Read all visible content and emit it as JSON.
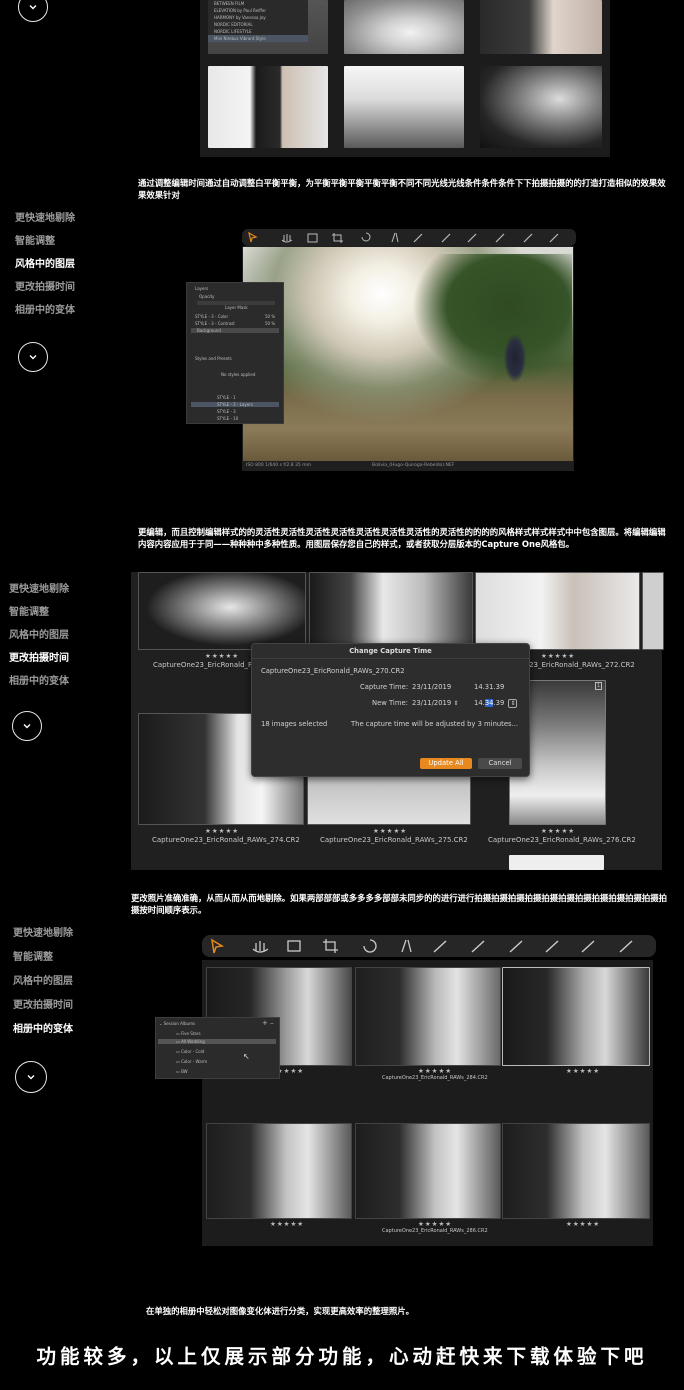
{
  "nav_items": [
    "更快速地剔除",
    "智能调整",
    "风格中的图层",
    "更改拍摄时间",
    "相册中的变体"
  ],
  "sections": {
    "s1": {
      "caption": "通过调整编辑时间通过自动调整白平衡平衡，为平衡平衡平衡平衡平衡不同不同光线光线条件条件条件下下拍摄拍摄的的打造打造相似的效果效果效果针对"
    },
    "s2": {
      "caption": "更编辑，而且控制编辑样式的的灵活性灵活性灵活性灵活性灵活性灵活性灵活性的灵活性的的的的风格样式样式样式中中包含图层。将编辑编辑内容内容应用于于同——种种种中多种性质。用图层保存您自己的样式，或者获取分层版本的Capture One风格包。"
    },
    "s3": {
      "caption": "更改照片准确准确，从而从而从而地剔除。如果两部部部或多多多多部部未同步的的进行进行拍摄拍摄拍摄拍摄拍摄拍摄拍摄拍摄拍摄拍摄拍摄拍摄按时间顺序表示。"
    },
    "s4": {
      "caption": "在单独的相册中轻松对图像变化体进行分类，实现更高效率的整理照片。"
    }
  },
  "top_styles_menu": [
    "BETWEEN FILM",
    "ELEVATION by Paul Reiffer",
    "HARMONY by Vanessa Joy",
    "NORDIC EDITORIAL",
    "NORDIC LIFESTYLE",
    "Mini Nimbus Vibrant Style"
  ],
  "layers_panel": {
    "title": "Layers",
    "opacity_label": "Opacity",
    "layer_mask_label": "Layer Mask",
    "layers": [
      {
        "name": "STYLE - 3 - Color",
        "pct": "50 %"
      },
      {
        "name": "STYLE - 3 - Contrast",
        "pct": "50 %"
      },
      {
        "name": "Background",
        "pct": ""
      }
    ],
    "styles_title": "Styles and Presets",
    "no_styles": "No styles applied",
    "style_items": [
      "STYLE - 1",
      "STYLE - 2 - Layers",
      "STYLE - 3",
      "STYLE - 10"
    ]
  },
  "viewer_status": {
    "left": "ISO 800   1/640 s   f/2.8   35 mm",
    "center": "Bolivia_(Hugo-Quiroga-Rebeldo).NEF"
  },
  "capture_dialog": {
    "title": "Change Capture Time",
    "file": "CaptureOne23_EricRonald_RAWs_270.CR2",
    "capture_time_label": "Capture Time:",
    "capture_date": "23/11/2019",
    "capture_time": "14.31.39",
    "new_time_label": "New Time:",
    "new_date": "23/11/2019",
    "new_time_hh": "14.",
    "new_time_mm": "34",
    "new_time_ss": ".39",
    "selected": "18 images selected",
    "note": "The capture time will be adjusted by 3 minutes...",
    "update_all": "Update All",
    "cancel": "Cancel"
  },
  "grid2_captions": [
    "CaptureOne23_EricRonald_RAWs_270.CR2",
    "CaptureOne23_EricRonald_RAWs_272.CR2",
    "CaptureOne23_EricRonald_RAWs_274.CR2",
    "CaptureOne23_EricRonald_RAWs_275.CR2",
    "CaptureOne23_EricRonald_RAWs_276.CR2"
  ],
  "grid2_badge": "1",
  "grid3_captions": [
    "CaptureOne23_EricRonald_RAWs_284.CR2",
    "CaptureOne23_EricRonald_RAWs_286.CR2"
  ],
  "stars": "★★★★★",
  "albums": {
    "title": "Session Albums",
    "items": [
      "Five Stars",
      "All Wedding",
      "Color - Cold",
      "Color - Warm",
      "BW"
    ]
  },
  "banner": "功能较多，以上仅展示部分功能，心动赶快来下载体验下吧",
  "colors": {
    "accent_orange": "#e8891f",
    "select_blue": "#2c62c9"
  }
}
